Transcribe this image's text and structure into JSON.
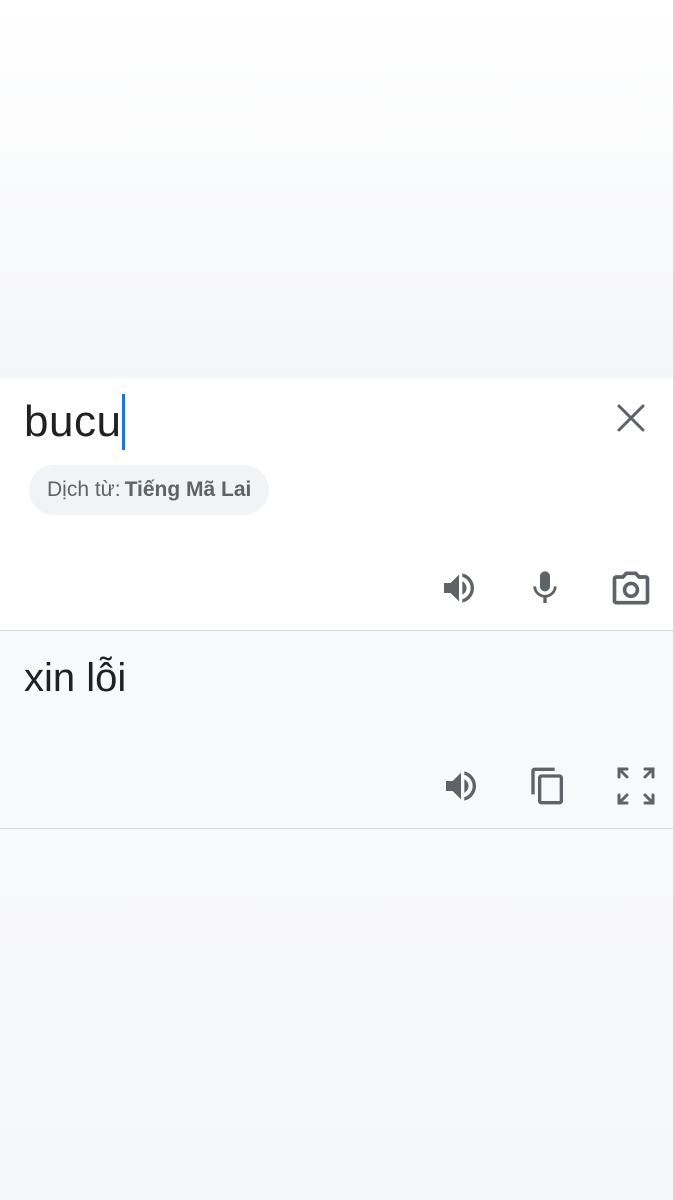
{
  "source": {
    "text": "bucu",
    "clear_icon": "close-icon",
    "language_label": "Dịch từ:",
    "language_name": "Tiếng Mã Lai",
    "actions": [
      "speaker-icon",
      "microphone-icon",
      "camera-icon"
    ]
  },
  "result": {
    "text": "xin lỗi",
    "actions": [
      "speaker-icon",
      "copy-icon",
      "fullscreen-icon"
    ]
  },
  "colors": {
    "caret": "#1a73e8",
    "icon": "#5f6368",
    "text": "#202124",
    "chip_background": "#f1f3f4"
  }
}
